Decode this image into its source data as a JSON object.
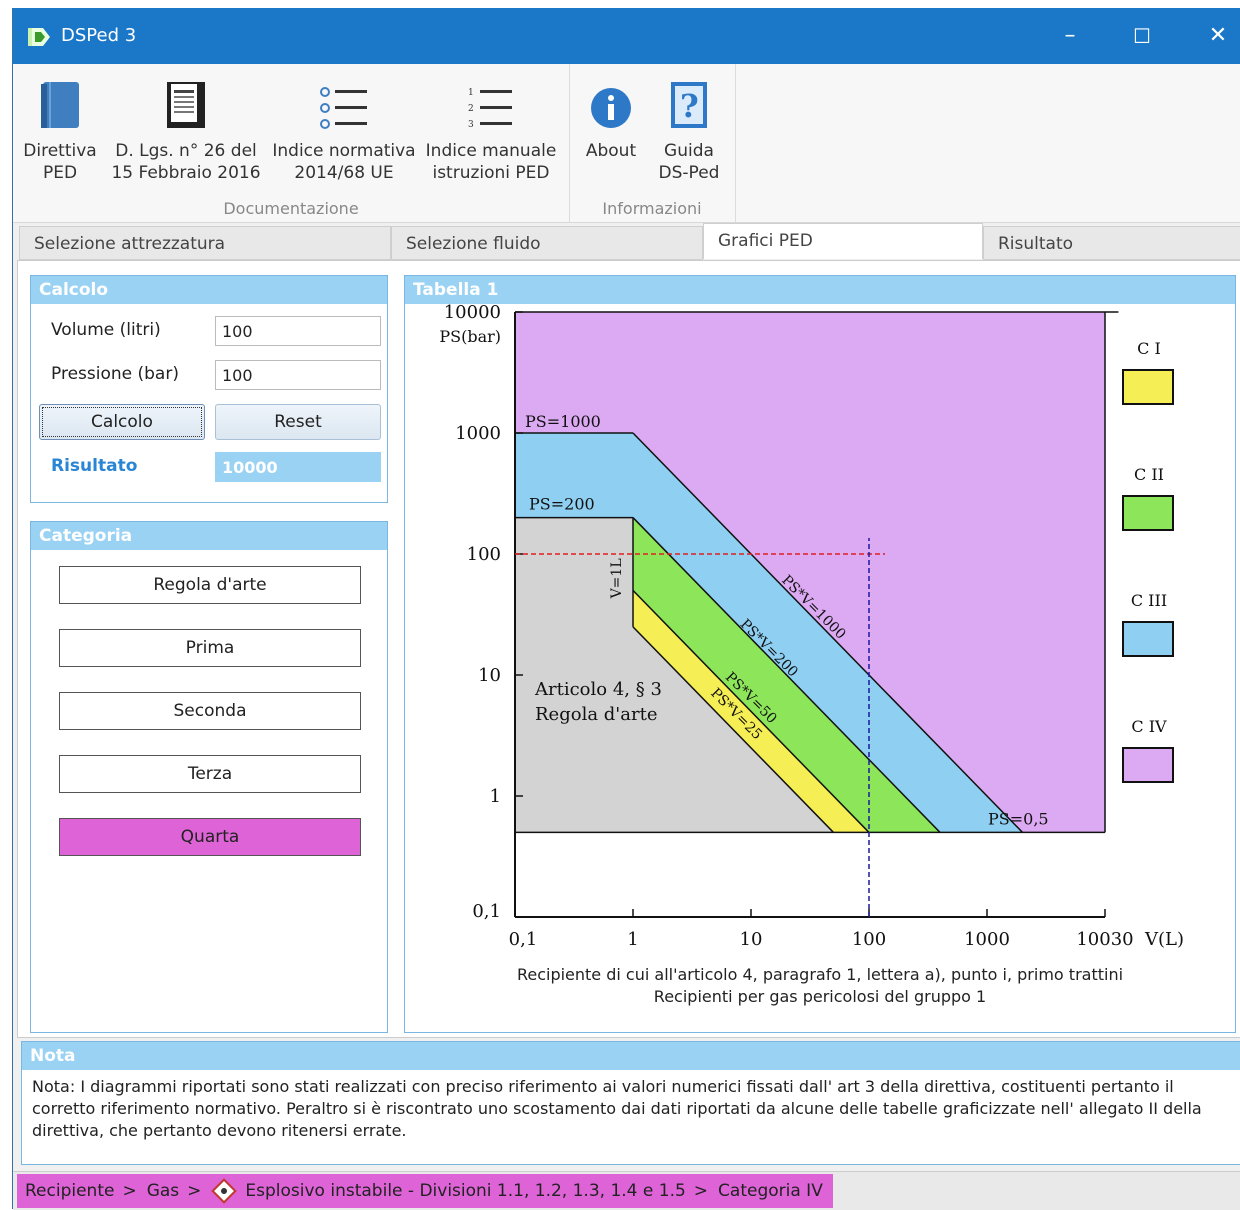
{
  "window": {
    "title": "DSPed 3",
    "minimize": "–",
    "maximize": "☐",
    "close": "✕"
  },
  "ribbon": {
    "groups": [
      {
        "label": "Documentazione",
        "buttons": [
          {
            "line1": "Direttiva",
            "line2": "PED"
          },
          {
            "line1": "D. Lgs. n° 26 del",
            "line2": "15 Febbraio 2016"
          },
          {
            "line1": "Indice normativa",
            "line2": "2014/68 UE"
          },
          {
            "line1": "Indice manuale",
            "line2": "istruzioni PED"
          }
        ]
      },
      {
        "label": "Informazioni",
        "buttons": [
          {
            "line1": "About",
            "line2": ""
          },
          {
            "line1": "Guida",
            "line2": "DS-Ped"
          }
        ]
      }
    ]
  },
  "tabs": [
    {
      "label": "Selezione attrezzatura",
      "active": false
    },
    {
      "label": "Selezione fluido",
      "active": false
    },
    {
      "label": "Grafici PED",
      "active": true
    },
    {
      "label": "Risultato",
      "active": false
    }
  ],
  "calcolo": {
    "title": "Calcolo",
    "volume_label": "Volume (litri)",
    "volume_value": "100",
    "pressione_label": "Pressione (bar)",
    "pressione_value": "100",
    "calcolo_button": "Calcolo",
    "reset_button": "Reset",
    "risultato_label": "Risultato",
    "risultato_value": "10000"
  },
  "categoria": {
    "title": "Categoria",
    "items": [
      "Regola d'arte",
      "Prima",
      "Seconda",
      "Terza",
      "Quarta"
    ],
    "selected": "Quarta"
  },
  "tabella": {
    "title": "Tabella 1",
    "caption_line1": "Recipiente di cui all'articolo 4, paragrafo 1, lettera a), punto i, primo trattini",
    "caption_line2": "Recipienti per gas pericolosi del gruppo 1"
  },
  "chart_data": {
    "type": "area",
    "x_scale": "log",
    "y_scale": "log",
    "xlabel": "V(L)",
    "ylabel": "PS(bar)",
    "xlim": [
      0.1,
      10000
    ],
    "ylim": [
      0.1,
      10000
    ],
    "x_ticks": [
      "0,1",
      "1",
      "10",
      "100",
      "1000",
      "10030"
    ],
    "y_ticks": [
      "0,1",
      "1",
      "10",
      "100",
      "1000",
      "10000"
    ],
    "regions": [
      {
        "name": "C IV",
        "color": "#dcaaf2",
        "boundary": "PS > 1000 or PS*V > 1000"
      },
      {
        "name": "C III",
        "color": "#8fd0f2",
        "boundary": "PS*V between 200 and 1000"
      },
      {
        "name": "C II",
        "color": "#8de65a",
        "boundary": "PS*V between 50 and 200"
      },
      {
        "name": "C I",
        "color": "#f6ee55",
        "boundary": "PS*V between 25 and 50"
      },
      {
        "name": "Regola d'arte",
        "color": "#d3d3d3",
        "boundary": "PS*V < 25"
      }
    ],
    "limit_lines": [
      {
        "label": "PS=1000",
        "ps": 1000
      },
      {
        "label": "PS=200",
        "ps": 200
      },
      {
        "label": "PS=0,5",
        "ps": 0.5
      },
      {
        "label": "V=1L",
        "v": 1
      },
      {
        "label": "PS*V=1000",
        "product": 1000
      },
      {
        "label": "PS*V=200",
        "product": 200
      },
      {
        "label": "PS*V=50",
        "product": 50
      },
      {
        "label": "PS*V=25",
        "product": 25
      }
    ],
    "annotation": [
      "Articolo 4, § 3",
      "Regola d'arte"
    ],
    "input_point": {
      "v": 100,
      "ps": 100
    },
    "legend": {
      "placement": "right",
      "items": [
        {
          "label": "C I",
          "color": "#f6ee55"
        },
        {
          "label": "C II",
          "color": "#8de65a"
        },
        {
          "label": "C III",
          "color": "#8fd0f2"
        },
        {
          "label": "C IV",
          "color": "#dcaaf2"
        }
      ]
    }
  },
  "nota": {
    "title": "Nota",
    "text": "Nota: I diagrammi riportati sono stati realizzati con preciso riferimento ai valori numerici fissati dall' art 3 della direttiva, costituenti pertanto il corretto riferimento normativo. Peraltro si è riscontrato uno scostamento dai dati riportati da alcune delle tabelle graficizzate nell' allegato II della direttiva, che pertanto devono ritenersi errate."
  },
  "breadcrumb": {
    "items": [
      "Recipiente",
      "Gas",
      "Esplosivo instabile - Divisioni 1.1, 1.2, 1.3, 1.4 e 1.5",
      "Categoria IV"
    ],
    "separator": ">"
  },
  "colors": {
    "titlebar": "#1b78c8",
    "panel_header": "#9ad2f4",
    "selected_category": "#dd63d6"
  }
}
